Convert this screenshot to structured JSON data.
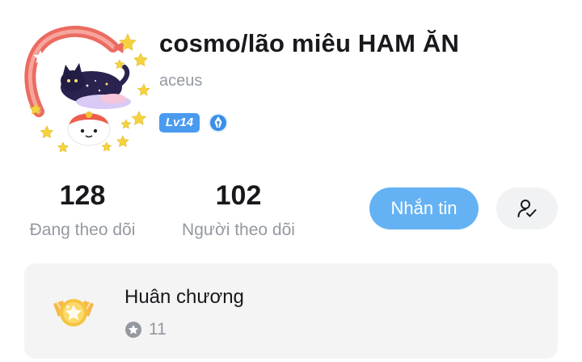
{
  "profile": {
    "nickname": "cosmo/lão miêu HAM ĂN",
    "username": "aceus",
    "level": "Lv14"
  },
  "stats": {
    "following_count": "128",
    "following_label": "Đang theo dõi",
    "followers_count": "102",
    "followers_label": "Người theo dõi"
  },
  "actions": {
    "message_label": "Nhắn tin"
  },
  "medal": {
    "title": "Huân chương",
    "count": "11"
  },
  "colors": {
    "accent": "#64b2f3",
    "level_badge": "#4a9bf0",
    "muted_text": "#9499a0"
  },
  "icons": {
    "verify": "verified-pen-icon",
    "follow_toggle": "user-check-icon",
    "medal": "medal-icon",
    "medal_count": "star-circle-icon"
  }
}
